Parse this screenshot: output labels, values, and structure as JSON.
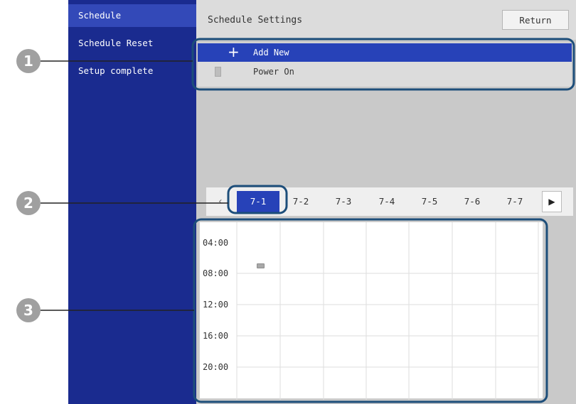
{
  "sidebar": {
    "items": [
      {
        "label": "Schedule"
      },
      {
        "label": "Schedule Reset"
      },
      {
        "label": "Setup complete"
      }
    ]
  },
  "header": {
    "title": "Schedule Settings",
    "return_label": "Return"
  },
  "schedule_list": {
    "add_new_label": "Add New",
    "add_icon": "+",
    "entries": [
      {
        "label": "Power On"
      }
    ]
  },
  "date_tabs": {
    "prev_icon": "‹",
    "next_icon": "▶",
    "tabs": [
      {
        "label": "7-1"
      },
      {
        "label": "7-2"
      },
      {
        "label": "7-3"
      },
      {
        "label": "7-4"
      },
      {
        "label": "7-5"
      },
      {
        "label": "7-6"
      },
      {
        "label": "7-7"
      }
    ]
  },
  "timeline": {
    "hours": [
      "04:00",
      "08:00",
      "12:00",
      "16:00",
      "20:00"
    ]
  },
  "callouts": [
    "1",
    "2",
    "3"
  ],
  "colors": {
    "sidebar": "#1a2b8f",
    "sidebar_active": "#3349b8",
    "selection": "#2742b8",
    "callout_outline": "#1d4e7a",
    "callout_badge": "#a0a0a0"
  }
}
